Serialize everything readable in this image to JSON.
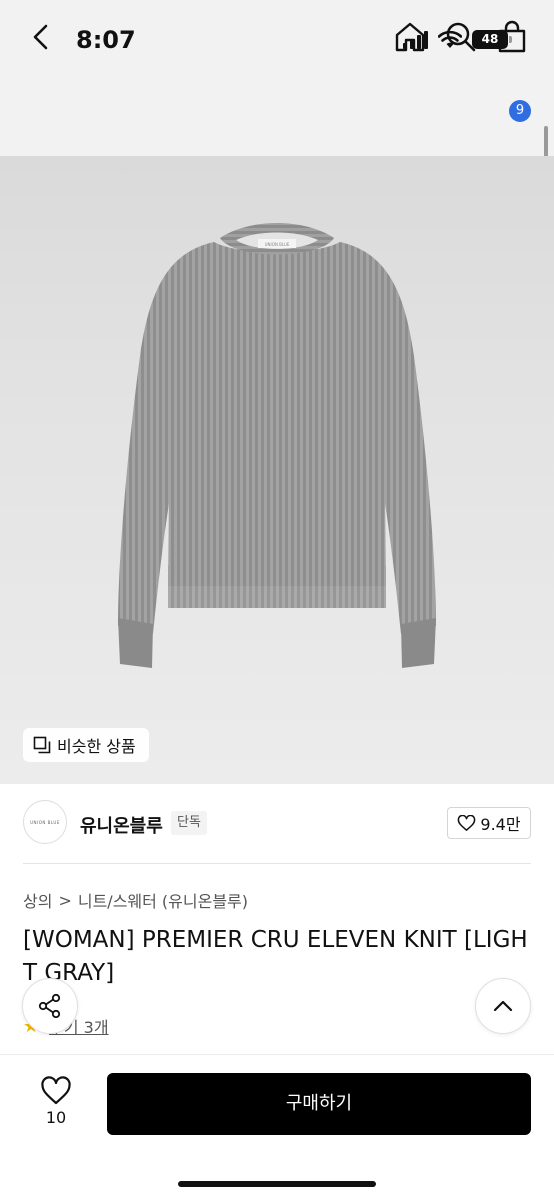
{
  "status_bar": {
    "time": "8:07",
    "battery": "48"
  },
  "nav": {
    "cart_count": "9"
  },
  "hero": {
    "similar_label": "비슷한 상품",
    "garment_label": "UNION BLUE"
  },
  "brand": {
    "logo_text": "UNION BLUE",
    "name": "유니온블루",
    "tag": "단독",
    "likes": "9.4만"
  },
  "breadcrumb": {
    "category": "상의",
    "separator": ">",
    "subcategory": "니트/스웨터 (유니온블루)"
  },
  "product": {
    "title": "[WOMAN] PREMIER CRU ELEVEN KNIT [LIGHT GRAY]"
  },
  "rating": {
    "reviews": "후기 3개"
  },
  "bottom": {
    "wish_count": "10",
    "buy_label": "구매하기"
  },
  "colors": {
    "accent": "#2f6de1",
    "star": "#f0b400",
    "buy_bg": "#000000"
  }
}
